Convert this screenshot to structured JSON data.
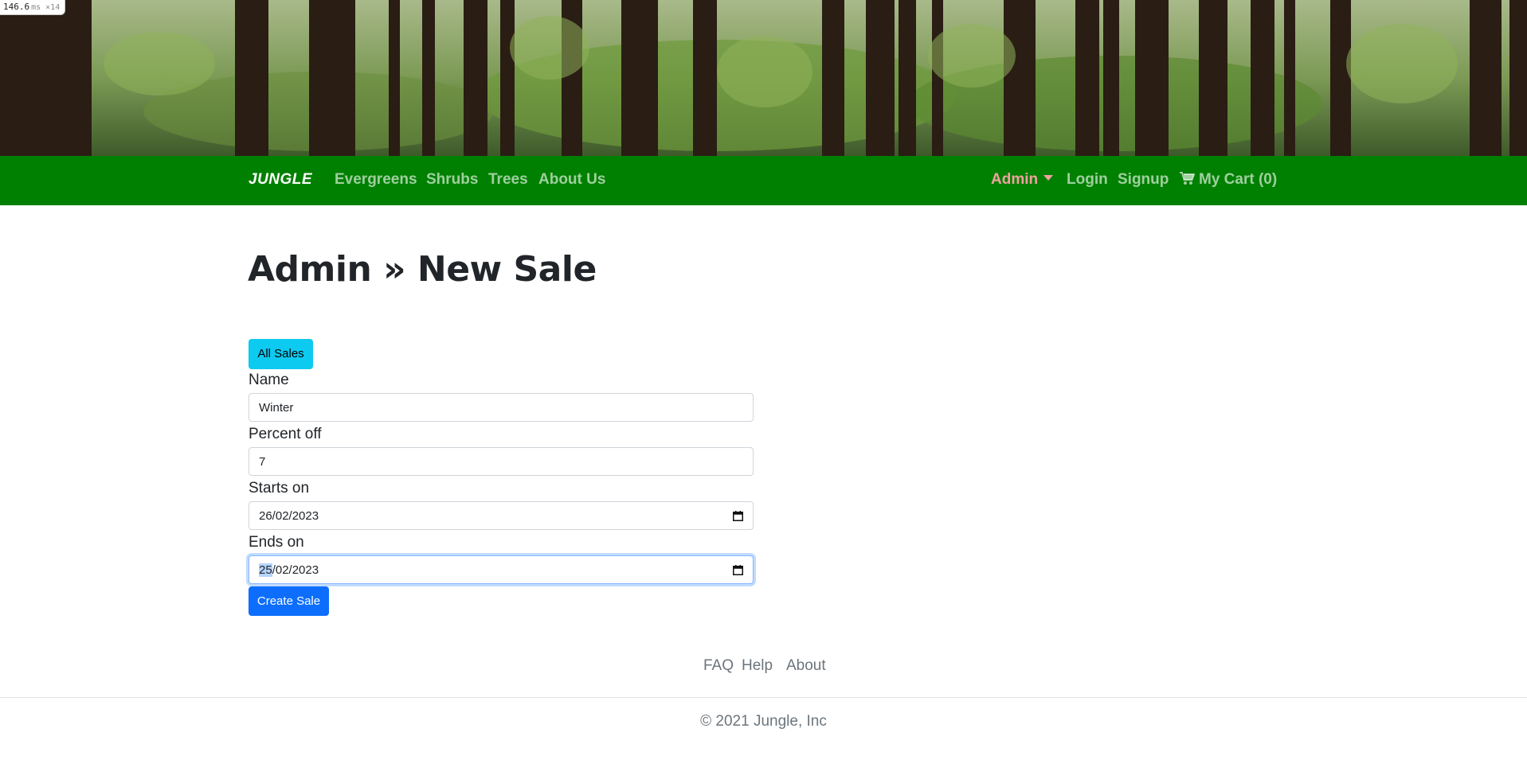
{
  "perf": {
    "value": "146.6",
    "unit": "ms ×14"
  },
  "hero": {
    "image": "forest-banner"
  },
  "navbar": {
    "brand": "JUNGLE",
    "links": [
      "Evergreens",
      "Shrubs",
      "Trees",
      "About Us"
    ],
    "admin": "Admin",
    "login": "Login",
    "signup": "Signup",
    "cart": "My Cart (0)",
    "cart_icon": "cart-icon",
    "bg_color": "#008000"
  },
  "page": {
    "title": "Admin » New Sale"
  },
  "form": {
    "all_sales_button": "All Sales",
    "name_label": "Name",
    "name_value": "Winter",
    "percent_label": "Percent off",
    "percent_value": "7",
    "starts_label": "Starts on",
    "starts_value": "26/02/2023",
    "ends_label": "Ends on",
    "ends_value_selected": "25",
    "ends_value_rest": "/02/2023",
    "submit_button": "Create Sale",
    "calendar_icon": "calendar-icon"
  },
  "footer": {
    "links": [
      "FAQ",
      "Help",
      "About"
    ],
    "copyright": "© 2021 Jungle, Inc"
  }
}
